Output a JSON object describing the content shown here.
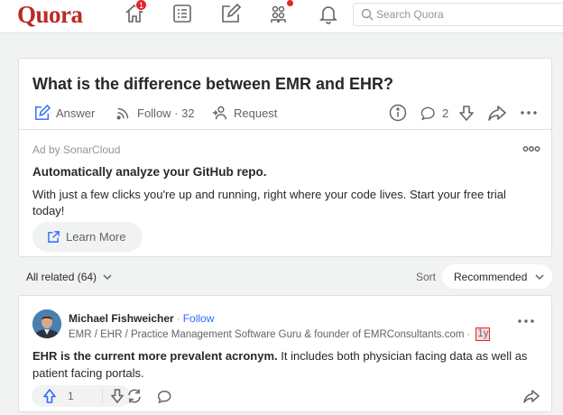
{
  "header": {
    "logo": "Quora",
    "notification_count": "1",
    "search_placeholder": "Search Quora",
    "nav_icons": [
      "home-icon",
      "following-icon",
      "answer-icon",
      "spaces-icon",
      "notifications-icon"
    ]
  },
  "question": {
    "title": "What is the difference between EMR and EHR?",
    "answer_label": "Answer",
    "follow_label": "Follow · 32",
    "request_label": "Request",
    "comment_count": "2"
  },
  "ad": {
    "by": "Ad by SonarCloud",
    "title": "Automatically analyze your GitHub repo.",
    "body": "With just a few clicks you're up and running, right where your code lives. Start your free trial today!",
    "button_label": "Learn More"
  },
  "filter": {
    "related_label": "All related (64)",
    "sort_label": "Sort",
    "sort_value": "Recommended"
  },
  "answer": {
    "author": "Michael Fishweicher",
    "separator": "·",
    "follow": "Follow",
    "credential": "EMR / EHR / Practice Management Software Guru & founder of EMRConsultants.com",
    "time": "1y",
    "text_bold": "EHR is the current more prevalent acronym.",
    "text_rest": " It includes both physician facing data as well as patient facing portals.",
    "upvotes": "1"
  },
  "colors": {
    "brand": "#b92b27",
    "link": "#2e69ff",
    "badge": "#e3242b"
  }
}
